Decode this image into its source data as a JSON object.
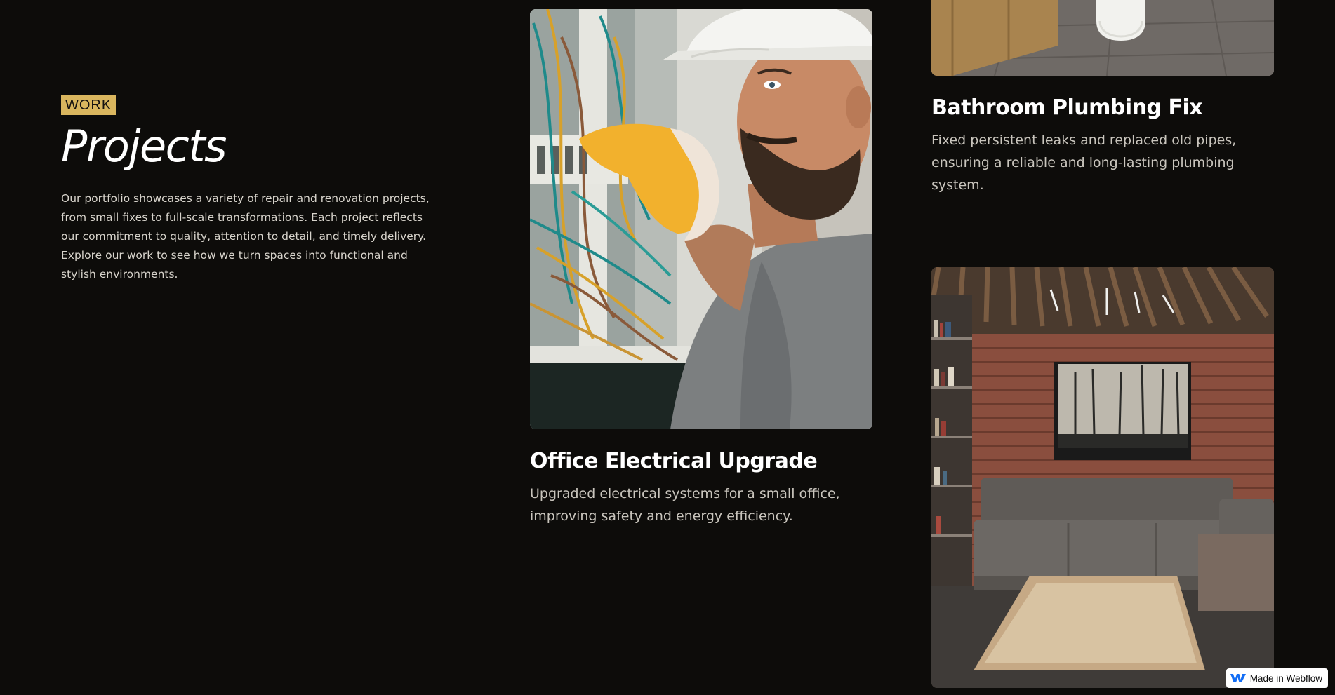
{
  "intro": {
    "tag": "WORK",
    "title": "Projects",
    "description": "Our portfolio showcases a variety of repair and renovation projects, from small fixes to full-scale transformations. Each project reflects our commitment to quality, attention to detail, and timely delivery. Explore our work to see how we turn spaces into functional and stylish environments."
  },
  "projects": [
    {
      "title": "Office Electrical Upgrade",
      "description": "Upgraded electrical systems for a small office, improving safety and energy efficiency.",
      "image_subject": "electrician in hard hat working on electrical panel"
    },
    {
      "title": "Bathroom Plumbing Fix",
      "description": "Fixed persistent leaks and replaced old pipes, ensuring a reliable and long-lasting plumbing system.",
      "image_subject": "bathroom with wooden cabinet and white fixture"
    },
    {
      "title": "",
      "description": "",
      "image_subject": "living room with brick wall, grey sofa and rug"
    }
  ],
  "badge": {
    "label": "Made in Webflow",
    "icon": "webflow-logo-icon"
  },
  "colors": {
    "background": "#0d0c0a",
    "accent": "#d9b65e",
    "webflow_blue": "#146ef5"
  }
}
